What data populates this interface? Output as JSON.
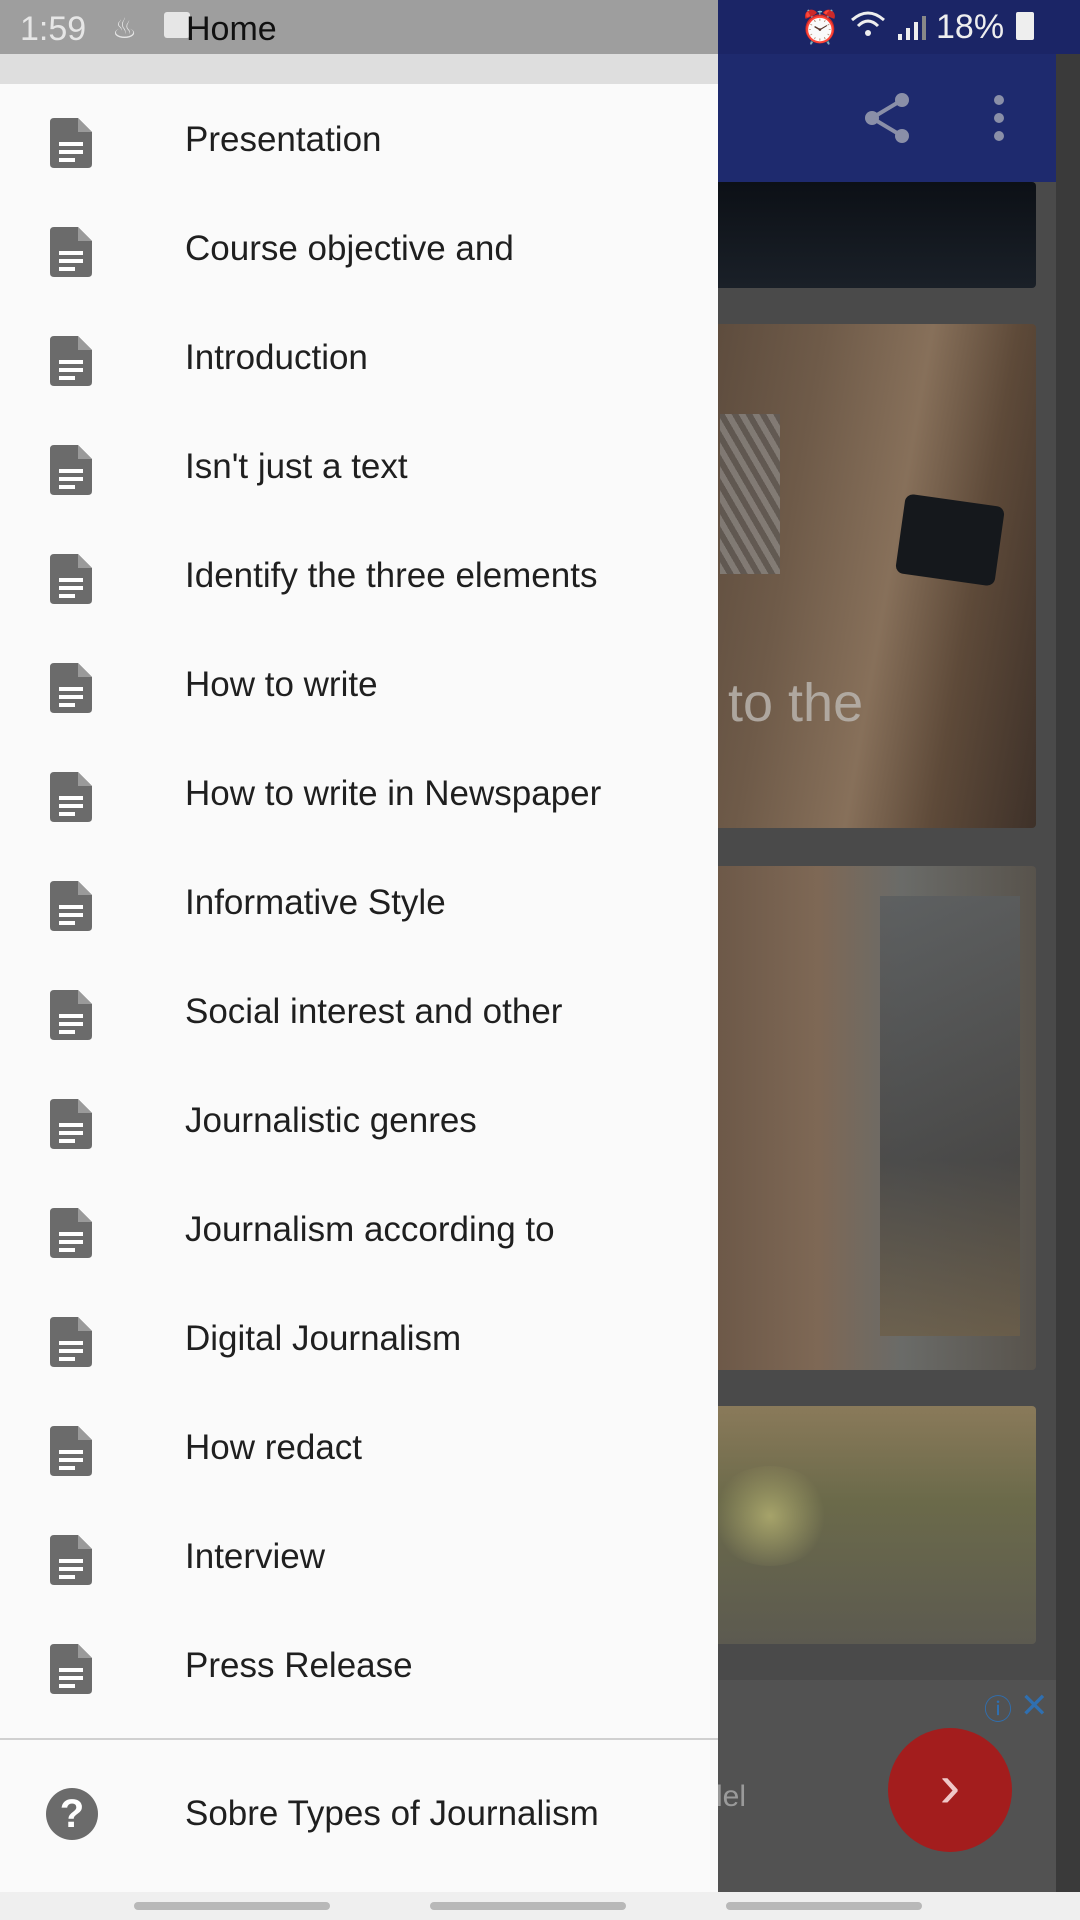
{
  "status_bar": {
    "time": "1:59",
    "title": "Home",
    "battery": "18%"
  },
  "background": {
    "caption": "to the",
    "ad_partial_text": "lel"
  },
  "drawer": {
    "items": [
      {
        "label": "Presentation",
        "icon": "document-icon"
      },
      {
        "label": "Course objective and",
        "icon": "document-icon"
      },
      {
        "label": "Introduction",
        "icon": "document-icon"
      },
      {
        "label": "Isn't just a text",
        "icon": "document-icon"
      },
      {
        "label": "Identify the three elements",
        "icon": "document-icon"
      },
      {
        "label": "How to write",
        "icon": "document-icon"
      },
      {
        "label": "How to write in Newspaper",
        "icon": "document-icon"
      },
      {
        "label": "Informative Style",
        "icon": "document-icon"
      },
      {
        "label": "Social interest and other",
        "icon": "document-icon"
      },
      {
        "label": "Journalistic genres",
        "icon": "document-icon"
      },
      {
        "label": "Journalism according to",
        "icon": "document-icon"
      },
      {
        "label": "Digital Journalism",
        "icon": "document-icon"
      },
      {
        "label": "How redact",
        "icon": "document-icon"
      },
      {
        "label": "Interview",
        "icon": "document-icon"
      },
      {
        "label": "Press Release",
        "icon": "document-icon"
      }
    ],
    "help_item": {
      "label": "Sobre Types of Journalism",
      "icon": "help-icon"
    }
  },
  "colors": {
    "toolbar": "#1e2a6e",
    "drawer_bg": "#fafafa",
    "icon_gray": "#6b6b6b",
    "fab_red": "#a31d1d"
  }
}
